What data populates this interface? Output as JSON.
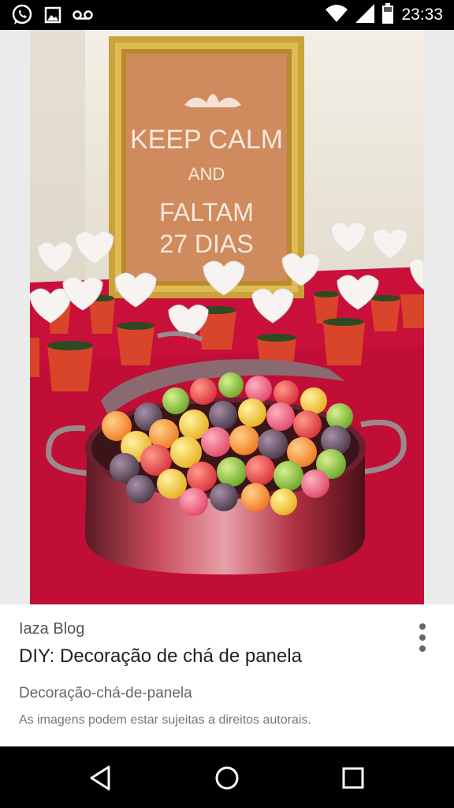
{
  "status_bar": {
    "time": "23:33",
    "left_icons": [
      "whatsapp-icon",
      "image-icon",
      "voicemail-icon"
    ],
    "right_icons": [
      "wifi-icon",
      "signal-icon",
      "battery-icon"
    ]
  },
  "photo": {
    "sign_lines": [
      "KEEP CALM",
      "AND",
      "FALTAM",
      "27 DIAS"
    ],
    "colors": {
      "tablecloth": "#c8103a",
      "wall": "#ece8e0",
      "frame": "#c9a23a"
    }
  },
  "result": {
    "source": "Iaza Blog",
    "title": "DIY: Decoração de chá de panela",
    "subtitle": "Decoração-chá-de-panela",
    "copyright": "As imagens podem estar sujeitas a direitos autorais."
  },
  "nav_bar": {
    "buttons": [
      "back-icon",
      "home-icon",
      "recents-icon"
    ]
  }
}
